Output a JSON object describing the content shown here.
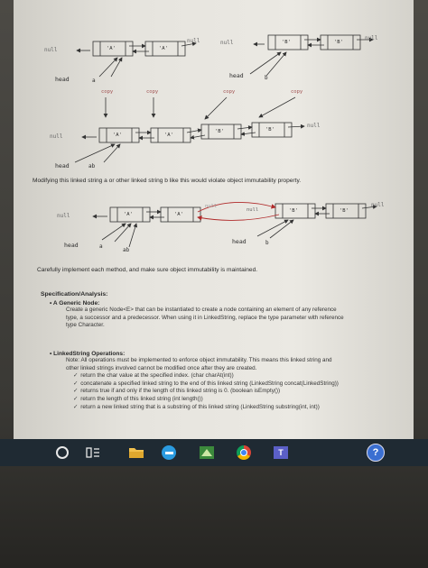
{
  "diagram1": {
    "top_left": {
      "null_left": "null",
      "nodes": [
        "'A'",
        "'A'"
      ],
      "null_right": "null",
      "head": "head",
      "var": "a"
    },
    "top_right": {
      "null_left": "null",
      "nodes": [
        "'B'",
        "'B'"
      ],
      "null_right": "null",
      "head": "head",
      "var": "b"
    },
    "copy_labels": [
      "copy",
      "copy",
      "copy",
      "copy"
    ],
    "result": {
      "null_left": "null",
      "nodes": [
        "'A'",
        "'A'",
        "'B'",
        "'B'"
      ],
      "null_right": "null",
      "head": "head",
      "var": "ab"
    }
  },
  "caption": "Modifying this linked string a or other linked string b like this would violate object immutability property.",
  "diagram2": {
    "left": {
      "null_left": "null",
      "nodes": [
        "'A'",
        "'A'"
      ],
      "null_right": "null",
      "head": "head",
      "var": "a"
    },
    "right": {
      "null_left": "null",
      "nodes": [
        "'B'",
        "'B'"
      ],
      "null_right": "null",
      "head": "head",
      "var": "b"
    },
    "var_ab": "ab"
  },
  "instruction": "Carefully implement each method, and make sure object immutability is maintained.",
  "spec": {
    "heading": "Specification/Analysis:",
    "item1": {
      "title": "A Generic Node:",
      "lines": [
        "Create a generic Node<E> that can be instantiated to create a node containing an element of any reference",
        "type, a successor and a predecessor. When using it in LinkedString, replace the type parameter with reference",
        "type Character."
      ]
    },
    "item2": {
      "title": "LinkedString Operations:",
      "note_lines": [
        "Note: All operations must be implemented to enforce object immutability. This means this linked string and",
        "other linked strings involved cannot be modified once after they are created."
      ],
      "ops": [
        "return the char value at the specified index. (char charAt(int))",
        "concatenate a specified linked string to the end of this linked string (LinkedString concat(LinkedString))",
        "returns true if and only if the length of this linked string is 0. (boolean isEmpty())",
        "return the length of this linked string (int length())",
        "return a new linked string that is a substring of this linked string (LinkedString substring(int, int))"
      ]
    }
  },
  "taskbar": {
    "items": [
      "start-circle",
      "task-view",
      "file-explorer",
      "edge",
      "app-green",
      "chrome",
      "teams",
      "help"
    ],
    "teams_label": "T"
  }
}
